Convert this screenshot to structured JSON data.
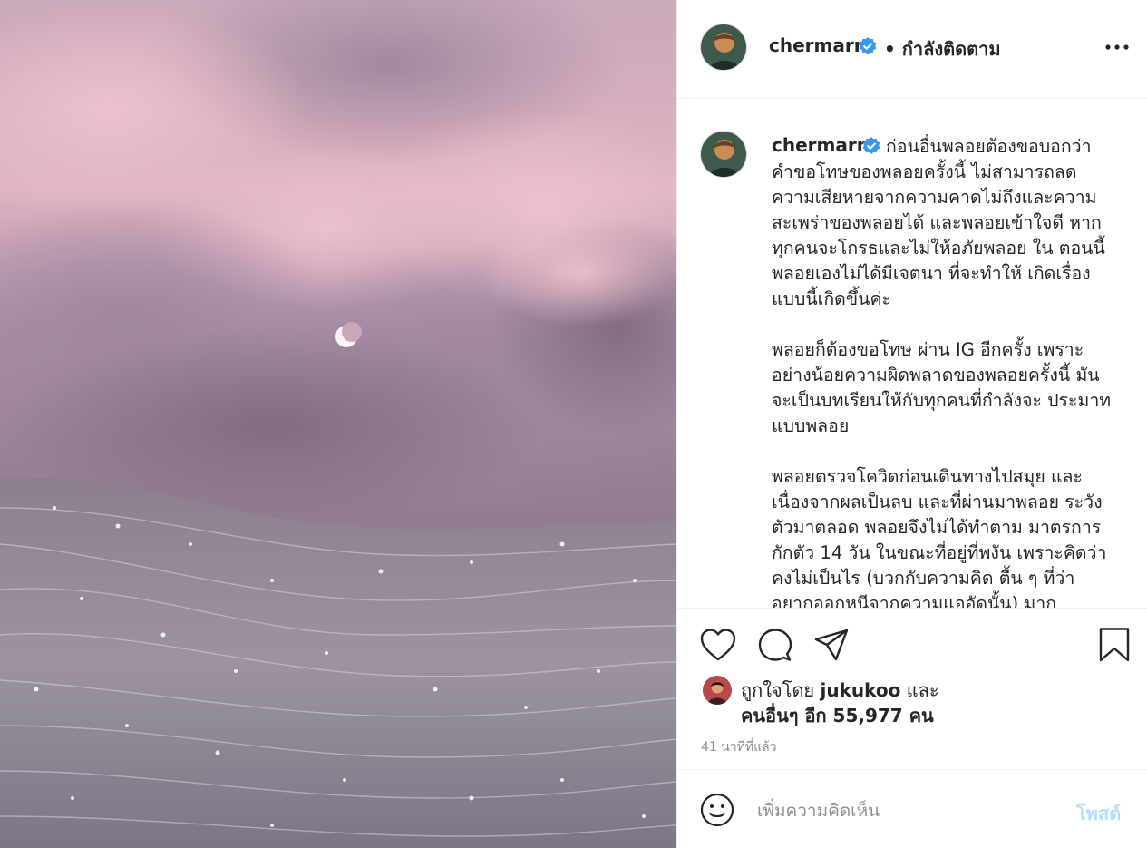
{
  "header": {
    "username": "chermarn",
    "separator": "•",
    "follow_status": "กำลังติดตาม",
    "more_icon": "more-horizontal-icon"
  },
  "caption": {
    "username": "chermarn",
    "text": "ก่อนอื่นพลอยต้องขอบอกว่า คำขอโทษของพลอยครั้งนี้ ไม่สามารถลด ความเสียหายจากความคาดไม่ถึงและความ สะเพร่าของพลอยได้ และพลอยเข้าใจดี หากทุกคนจะโกรธและไม่ให้อภัยพลอย ใน ตอนนี้ พลอยเองไม่ได้มีเจตนา ที่จะทำให้ เกิดเรื่องแบบนี้เกิดขึ้นค่ะ\n\nพลอยก็ต้องขอโทษ ผ่าน IG อีกครั้ง เพราะ อย่างน้อยความผิดพลาดของพลอยครั้งนี้ มันจะเป็นบทเรียนให้กับทุกคนที่กำลังจะ ประมาทแบบพลอย\n\nพลอยตรวจโควิดก่อนเดินทางไปสมุย และ เนื่องจากผลเป็นลบ และที่ผ่านมาพลอย ระวังตัวมาตลอด พลอยจึงไม่ได้ทำตาม มาตรการกักตัว 14 วัน ในขณะที่อยู่ที่พงัน เพราะคิดว่าคงไม่เป็นไร (บวกกับความคิด ตื้น ๆ ที่ว่าอยากออกหนีจากความแออัดนั้น) มาก"
  },
  "actions": {
    "like_icon": "heart-icon",
    "comment_icon": "comment-bubble-icon",
    "share_icon": "paper-plane-icon",
    "save_icon": "bookmark-icon"
  },
  "likes": {
    "prefix": "ถูกใจโดย",
    "liked_by_user": "jukukoo",
    "connector": "และ",
    "others_text": "คนอื่นๆ อีก 55,977 คน"
  },
  "timestamp": "41 นาทีที่แล้ว",
  "comment_box": {
    "emoji_icon": "smiley-icon",
    "placeholder": "เพิ่มความคิดเห็น",
    "post_label": "โพสต์"
  },
  "colors": {
    "verified_blue": "#3897f0",
    "post_button_disabled": "#b2dffc",
    "muted_text": "#8e8e8e",
    "border": "#efefef"
  }
}
